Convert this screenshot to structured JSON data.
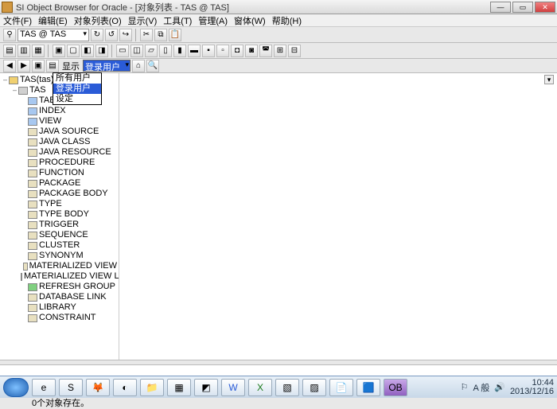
{
  "window": {
    "title": "SI Object Browser for Oracle - [对象列表 - TAS @ TAS]"
  },
  "menu": [
    "文件(F)",
    "编辑(E)",
    "对象列表(O)",
    "显示(V)",
    "工具(T)",
    "管理(A)",
    "窗体(W)",
    "帮助(H)"
  ],
  "toolbar1": {
    "connection": "TAS @ TAS"
  },
  "filter": {
    "label": "显示",
    "selected": "登录用户",
    "options": [
      "所有用户",
      "登录用户",
      "设定"
    ]
  },
  "tree": {
    "root": "TAS(tas)",
    "schema": "TAS",
    "objects": [
      "TABLE",
      "INDEX",
      "VIEW",
      "JAVA SOURCE",
      "JAVA CLASS",
      "JAVA RESOURCE",
      "PROCEDURE",
      "FUNCTION",
      "PACKAGE",
      "PACKAGE BODY",
      "TYPE",
      "TYPE BODY",
      "TRIGGER",
      "SEQUENCE",
      "CLUSTER",
      "SYNONYM",
      "MATERIALIZED VIEW",
      "MATERIALIZED VIEW LOG",
      "REFRESH GROUP",
      "DATABASE LINK",
      "LIBRARY",
      "CONSTRAINT"
    ]
  },
  "tabs": {
    "active": "TAS@TAS"
  },
  "status": {
    "text": "0个对象存在。"
  },
  "tray": {
    "ime": "A 般",
    "time": "10:44",
    "date": "2013/12/16"
  }
}
